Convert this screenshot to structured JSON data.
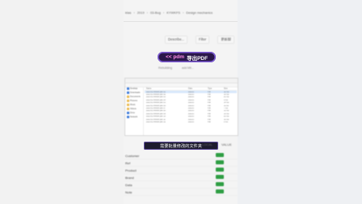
{
  "breadcrumb": [
    "ktas",
    "2019",
    "03-Bug",
    "KYWKFS",
    "Design mechanics"
  ],
  "toolbar": {
    "left": "Describe...",
    "middle": "Filter",
    "right": "更新脚"
  },
  "caption_bubble": {
    "part_a": "<< pdm",
    "part_b": "导出PDF"
  },
  "mini_row": [
    "Rebuilding",
    "add Mit..."
  ],
  "explorer": {
    "nav_items": [
      "Desktop",
      "Downloads",
      "Documents",
      "Pictures",
      "Music",
      "Videos",
      "Drive",
      "Network"
    ],
    "headers": [
      "Name",
      "Date",
      "Type",
      "Size"
    ],
    "rows": [
      {
        "name": "2021-03 Revise part 01",
        "date": "2021/3",
        "type": "File",
        "size": "12 KB",
        "selected": true
      },
      {
        "name": "2021-03 Revise part 02",
        "date": "2021/3",
        "type": "File",
        "size": "18 KB",
        "selected": false
      },
      {
        "name": "2021-03 Revise part 03",
        "date": "2021/3",
        "type": "File",
        "size": "21 KB",
        "selected": false
      },
      {
        "name": "2021-03 Revise part 04",
        "date": "2021/3",
        "type": "File",
        "size": "9 KB",
        "selected": false
      },
      {
        "name": "2021-03 Revise part 05",
        "date": "2021/3",
        "type": "File",
        "size": "14 KB",
        "selected": false
      },
      {
        "name": "2021-03 Revise part 06",
        "date": "2021/3",
        "type": "File",
        "size": "11 KB",
        "selected": false
      },
      {
        "name": "2021-03 Revise part 07",
        "date": "2021/3",
        "type": "File",
        "size": "7 KB",
        "selected": false
      },
      {
        "name": "2021-03 Revise part 08",
        "date": "2021/3",
        "type": "File",
        "size": "13 KB",
        "selected": false
      },
      {
        "name": "2021-03 Revise part 09",
        "date": "2021/3",
        "type": "File",
        "size": "16 KB",
        "selected": false
      },
      {
        "name": "2021-03 Revise part 10",
        "date": "2021/3",
        "type": "File",
        "size": "20 KB",
        "selected": false
      },
      {
        "name": "2021-03 Revise part 11",
        "date": "2021/3",
        "type": "File",
        "size": "10 KB",
        "selected": false
      },
      {
        "name": "2021-03 Revise part 12",
        "date": "2021/3",
        "type": "File",
        "size": "8 KB",
        "selected": false
      }
    ]
  },
  "caption_bottom": "需要批量修改的文件夹",
  "table_headers": [
    "",
    "",
    "",
    "",
    ""
  ],
  "table_rows": [
    {
      "c1": "Customer",
      "c2": "",
      "c3": "",
      "c4": "Yes"
    },
    {
      "c1": "Ref",
      "c2": "",
      "c3": "",
      "c4": "Yes"
    },
    {
      "c1": "Product",
      "c2": "",
      "c3": "",
      "c4": "Yes"
    },
    {
      "c1": "Brand",
      "c2": "",
      "c3": "",
      "c4": "Yes"
    },
    {
      "c1": "Data",
      "c2": "",
      "c3": "",
      "c4": "Yes"
    },
    {
      "c1": "Note",
      "c2": "",
      "c3": "",
      "c4": "Yes"
    }
  ],
  "right_labels": {
    "a": "LOCAL",
    "b": "VALUE"
  },
  "colors": {
    "accent": "#7d5bd6",
    "status_green": "#2f9e44"
  }
}
